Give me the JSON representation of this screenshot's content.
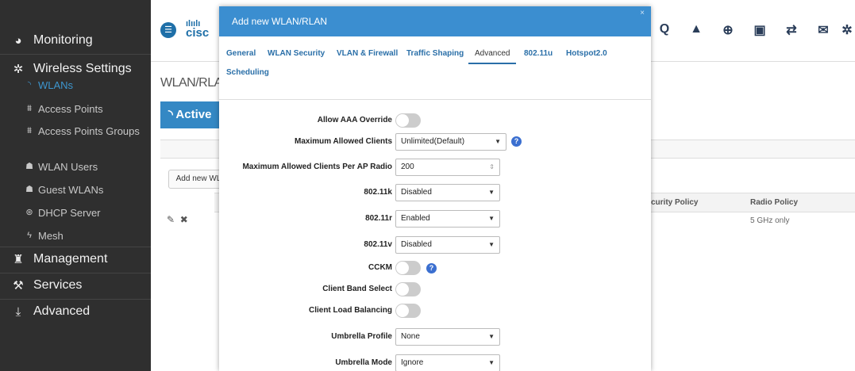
{
  "sidebar": {
    "monitoring": "Monitoring",
    "wireless_settings": "Wireless Settings",
    "items": [
      {
        "label": "WLANs"
      },
      {
        "label": "Access Points"
      },
      {
        "label": "Access Points Groups"
      },
      {
        "label": "WLAN Users"
      },
      {
        "label": "Guest WLANs"
      },
      {
        "label": "DHCP Server"
      },
      {
        "label": "Mesh"
      }
    ],
    "management": "Management",
    "services": "Services",
    "advanced": "Advanced"
  },
  "background": {
    "logo_text": "cisc",
    "breadcrumb": "WLAN/RLA",
    "active_tab": "Active",
    "add_new_button": "Add new WL",
    "table": {
      "headers": [
        "curity Policy",
        "Radio Policy"
      ],
      "row": {
        "radio_policy": "5 GHz only"
      }
    }
  },
  "modal": {
    "title": "Add new WLAN/RLAN",
    "close": "×",
    "tabs": [
      "General",
      "WLAN Security",
      "VLAN & Firewall",
      "Traffic Shaping",
      "Advanced",
      "802.11u",
      "Hotspot2.0",
      "Scheduling"
    ],
    "selected_tab": "Advanced",
    "fields": {
      "allow_aaa_override": {
        "label": "Allow AAA Override",
        "value": "off"
      },
      "max_clients": {
        "label": "Maximum Allowed Clients",
        "value": "Unlimited(Default)"
      },
      "max_clients_per_radio": {
        "label": "Maximum Allowed Clients Per AP Radio",
        "value": "200"
      },
      "dot11k": {
        "label": "802.11k",
        "value": "Disabled"
      },
      "dot11r": {
        "label": "802.11r",
        "value": "Enabled"
      },
      "dot11v": {
        "label": "802.11v",
        "value": "Disabled"
      },
      "cckm": {
        "label": "CCKM",
        "value": "off"
      },
      "client_band_select": {
        "label": "Client Band Select",
        "value": "off"
      },
      "client_load_balancing": {
        "label": "Client Load Balancing",
        "value": "off"
      },
      "umbrella_profile": {
        "label": "Umbrella Profile",
        "value": "None"
      },
      "umbrella_mode": {
        "label": "Umbrella Mode",
        "value": "Ignore"
      }
    }
  },
  "colors": {
    "accent": "#3b8ed0",
    "sidebar_bg": "#2f2f2f",
    "link": "#2a6fa8"
  }
}
